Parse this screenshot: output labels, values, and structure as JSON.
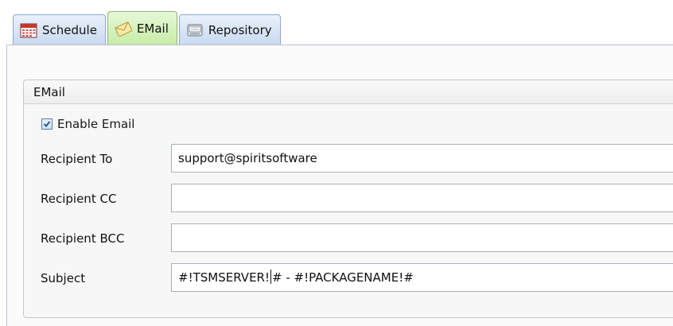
{
  "tabs": [
    {
      "label": "Schedule",
      "icon": "calendar-icon",
      "active": false
    },
    {
      "label": "EMail",
      "icon": "envelope-icon",
      "active": true
    },
    {
      "label": "Repository",
      "icon": "repository-icon",
      "active": false
    }
  ],
  "group": {
    "title": "EMail"
  },
  "enable_email": {
    "label": "Enable Email",
    "checked": true
  },
  "fields": {
    "to": {
      "label": "Recipient To",
      "value": "support@spiritsoftware"
    },
    "cc": {
      "label": "Recipient CC",
      "value": ""
    },
    "bcc": {
      "label": "Recipient BCC",
      "value": ""
    },
    "subject": {
      "label": "Subject",
      "value_before_caret": "#!TSMSERVER!",
      "value_after_caret": "# - #!PACKAGENAME!#"
    }
  },
  "colors": {
    "active_tab": "#c7eca6",
    "inactive_tab": "#c9daf0",
    "checkbox_border": "#5b7fa8"
  }
}
